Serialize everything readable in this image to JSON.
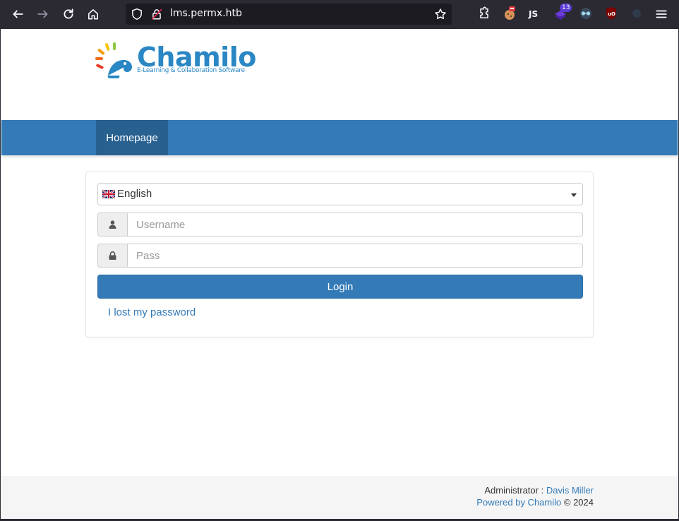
{
  "browser": {
    "url": "lms.permx.htb",
    "extension_badge": "13",
    "icons": [
      "back-icon",
      "forward-icon",
      "reload-icon",
      "home-icon",
      "shield-icon",
      "lock-icon",
      "bookmark-star-icon",
      "extensions-icon",
      "menu-icon"
    ]
  },
  "logo": {
    "name": "Chamilo",
    "tagline": "E-Learning & Collaboration Software"
  },
  "nav": {
    "home_label": "Homepage"
  },
  "login": {
    "language": "English",
    "username_placeholder": "Username",
    "password_placeholder": "Pass",
    "login_label": "Login",
    "lost_password": "I lost my password"
  },
  "footer": {
    "admin_label": "Administrator :",
    "admin_name": "Davis Miller",
    "powered_by": "Powered by Chamilo",
    "copyright": "© 2024"
  },
  "colors": {
    "primary": "#337ab7",
    "primary_dark": "#286090",
    "browser_bg": "#2b2a33"
  }
}
